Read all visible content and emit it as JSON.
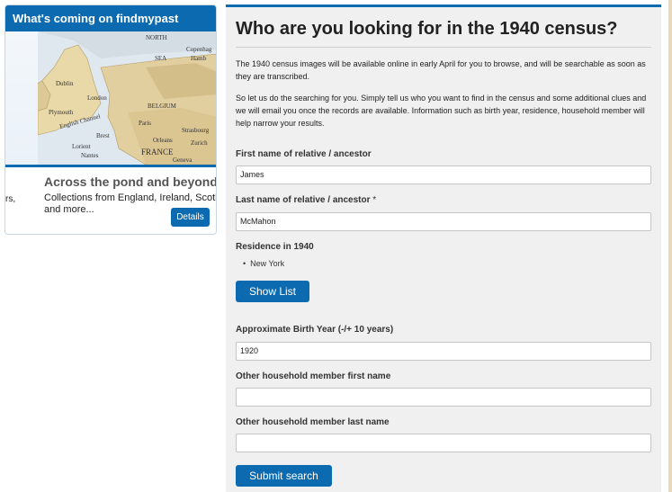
{
  "widget": {
    "header": "What's coming on findmypast",
    "slide_title": "Across the pond and beyond",
    "slide_text_line1": "Collections from England, Ireland, Scotland",
    "slide_text_line2": "and more...",
    "prev_slide_fragment": "rs,",
    "details_label": "Details",
    "map_labels": [
      "NORTH",
      "Copenhag",
      "SEA",
      "Hamb",
      "Dublin",
      "London",
      "Plymouth",
      "BELGIUM",
      "Paris",
      "Brest",
      "Lorient",
      "Nantes",
      "FRANCE",
      "Orleans",
      "Strasbourg",
      "Geneva",
      "Zurich",
      "English Channel"
    ]
  },
  "panel": {
    "title": "Who are you looking for in the 1940 census?",
    "para1": "The 1940 census images will be available online in early April for you to browse, and will be searchable as soon as they are transcribed.",
    "para2": "So let us do the searching for you. Simply tell us who you want to find in the census and some additional clues and we will email you once the records are available. Information such as birth year, residence, household member will help narrow your results.",
    "first_name_label": "First name of relative / ancestor",
    "first_name_value": "James",
    "last_name_label": "Last name of relative / ancestor",
    "required_marker": "*",
    "last_name_value": "McMahon",
    "residence_label": "Residence in 1940",
    "residence_value": "New York",
    "show_list_label": "Show List",
    "birth_year_label": "Approximate Birth Year (-/+ 10 years)",
    "birth_year_value": "1920",
    "household_first_label": "Other household member first name",
    "household_first_value": "",
    "household_last_label": "Other household member last name",
    "household_last_value": "",
    "submit_label": "Submit search"
  },
  "colors": {
    "accent": "#0c6bb0",
    "panel_bg": "#f0f0f0"
  }
}
